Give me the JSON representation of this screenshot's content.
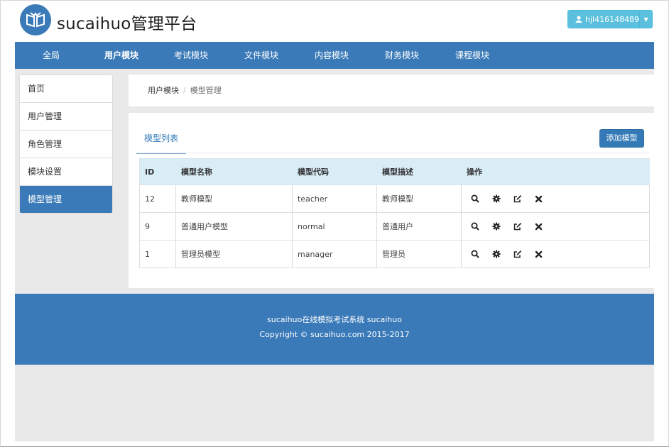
{
  "header": {
    "brand": "sucaihuo管理平台",
    "user_label": "hjl416148489"
  },
  "nav": {
    "items": [
      {
        "label": "全局",
        "active": false
      },
      {
        "label": "用户模块",
        "active": true
      },
      {
        "label": "考试模块",
        "active": false
      },
      {
        "label": "文件模块",
        "active": false
      },
      {
        "label": "内容模块",
        "active": false
      },
      {
        "label": "财务模块",
        "active": false
      },
      {
        "label": "课程模块",
        "active": false
      }
    ]
  },
  "sidebar": {
    "items": [
      {
        "label": "首页",
        "active": false
      },
      {
        "label": "用户管理",
        "active": false
      },
      {
        "label": "角色管理",
        "active": false
      },
      {
        "label": "模块设置",
        "active": false
      },
      {
        "label": "模型管理",
        "active": true
      }
    ]
  },
  "breadcrumb": {
    "parent": "用户模块",
    "separator": "/",
    "current": "模型管理"
  },
  "main": {
    "tab_label": "模型列表",
    "add_button_label": "添加模型",
    "table": {
      "columns": [
        "ID",
        "模型名称",
        "模型代码",
        "模型描述",
        "操作"
      ],
      "rows": [
        {
          "id": "12",
          "name": "教师模型",
          "code": "teacher",
          "desc": "教师模型"
        },
        {
          "id": "9",
          "name": "普通用户模型",
          "code": "normal",
          "desc": "普通用户"
        },
        {
          "id": "1",
          "name": "管理员模型",
          "code": "manager",
          "desc": "管理员"
        }
      ],
      "row_actions": [
        "search-icon",
        "gear-icon",
        "edit-icon",
        "delete-icon"
      ]
    }
  },
  "footer": {
    "line1": "sucaihuo在线模拟考试系统 sucaihuo",
    "line2": "Copyright © sucaihuo.com 2015-2017"
  },
  "colors": {
    "primary": "#3a7ab8",
    "info": "#5bc0de",
    "table_header": "#d9edf7",
    "content_bg": "#e9e9e9"
  }
}
